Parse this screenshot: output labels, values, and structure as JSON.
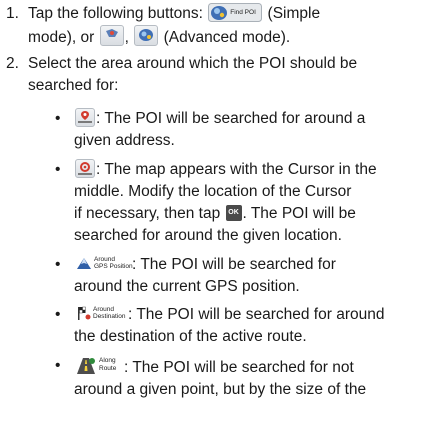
{
  "steps": [
    {
      "number": "1.",
      "line1_prefix": "Tap the following buttons:",
      "find_poi_label": "Find POI",
      "line1_suffix": "(Simple",
      "line2_a": "mode), or",
      "line2_sep": ",",
      "line2_b": "(Advanced mode)."
    },
    {
      "number": "2.",
      "text_line1": "Select the area around which the POI should be",
      "text_line2": "searched for:"
    }
  ],
  "bullets": [
    {
      "icon": "address-pin-icon",
      "line1": ": The POI will be searched for around a",
      "line2": "given address."
    },
    {
      "icon": "cursor-pin-icon",
      "line1": ": The map appears with the Cursor in the",
      "line2": "middle. Modify the location of the Cursor",
      "line3_a": "if necessary, then tap",
      "ok_label": "OK",
      "line3_b": ". The POI will be",
      "line4": "searched for around the given location."
    },
    {
      "icon": "gps-position-icon",
      "btn_label_1": "Around",
      "btn_label_2": "GPS Position",
      "line1": ": The POI will be searched for",
      "line2": "around the current GPS position."
    },
    {
      "icon": "destination-flag-icon",
      "btn_label_1": "Around",
      "btn_label_2": "Destination",
      "line1": ": The POI will be searched for around",
      "line2": "the destination of the active route."
    },
    {
      "icon": "along-route-icon",
      "btn_label_1": "Along",
      "btn_label_2": "Route",
      "line1": ": The POI will be searched for not",
      "line2": "around a given point, but by the size of the"
    }
  ],
  "bullet_glyph": "•"
}
